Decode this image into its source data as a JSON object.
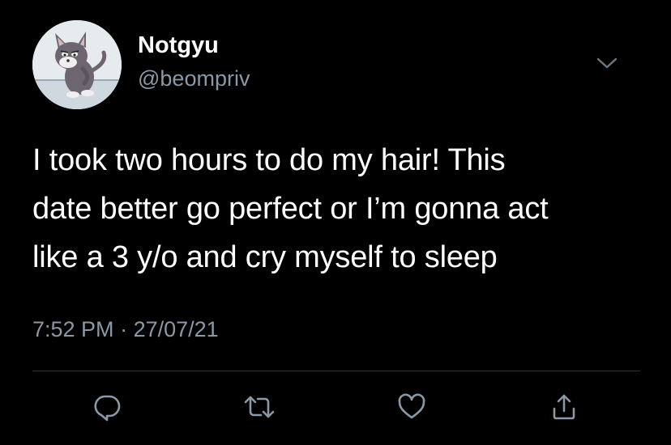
{
  "tweet": {
    "author": {
      "display_name": "Notgyu",
      "handle": "@beompriv",
      "avatar": "cartoon-kitten-avatar"
    },
    "text_lines": [
      "I took two hours to do my hair! This",
      "date better go perfect or I’m gonna act",
      "like a 3 y/o and cry myself to sleep"
    ],
    "time": "7:52 PM",
    "separator": " · ",
    "date": "27/07/21"
  },
  "actions": [
    {
      "name": "reply-icon"
    },
    {
      "name": "retweet-icon"
    },
    {
      "name": "like-icon"
    },
    {
      "name": "share-icon"
    }
  ],
  "colors": {
    "background": "#000000",
    "primary_text": "#ffffff",
    "secondary_text": "#8b98a5",
    "icon": "#8b98a5",
    "divider": "#2f3336"
  }
}
